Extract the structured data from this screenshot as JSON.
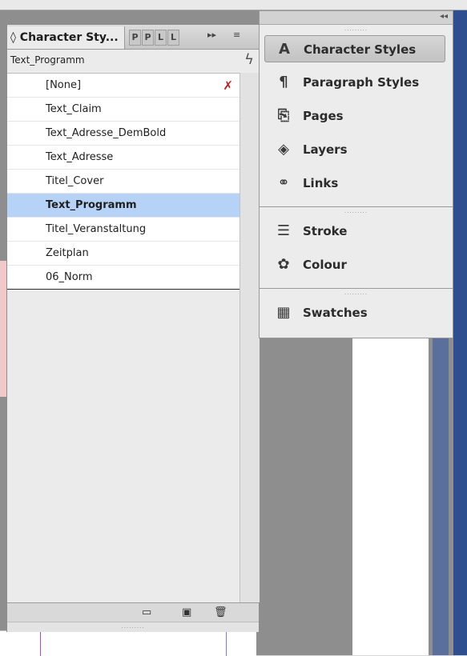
{
  "panel": {
    "active_tab": "◊ Character Sty...",
    "mini_tabs": [
      "P",
      "P",
      "L",
      "L"
    ],
    "tab_arrows": "▸▸",
    "menu_icon": "≡",
    "current_style": "Text_Programm",
    "styles": [
      {
        "label": "[None]"
      },
      {
        "label": "Text_Claim"
      },
      {
        "label": "Text_Adresse_DemBold"
      },
      {
        "label": "Text_Adresse"
      },
      {
        "label": "Titel_Cover"
      },
      {
        "label": "Text_Programm",
        "selected": true
      },
      {
        "label": "Titel_Veranstaltung"
      },
      {
        "label": "Zeitplan"
      },
      {
        "label": "06_Norm"
      }
    ],
    "none_icon": "✗"
  },
  "dock": {
    "collapse_icon": "◂◂",
    "groups": [
      {
        "items": [
          {
            "label": "Character Styles",
            "icon": "A",
            "active": true
          },
          {
            "label": "Paragraph Styles",
            "icon": "¶"
          },
          {
            "label": "Pages",
            "icon": "⎘"
          },
          {
            "label": "Layers",
            "icon": "◈"
          },
          {
            "label": "Links",
            "icon": "⚭"
          }
        ]
      },
      {
        "items": [
          {
            "label": "Stroke",
            "icon": "☰"
          },
          {
            "label": "Colour",
            "icon": "✿"
          }
        ]
      },
      {
        "items": [
          {
            "label": "Swatches",
            "icon": "▦"
          }
        ]
      }
    ]
  },
  "footer": {
    "folder_icon": "▭",
    "new_icon": "▣",
    "trash_icon": "🗑"
  }
}
